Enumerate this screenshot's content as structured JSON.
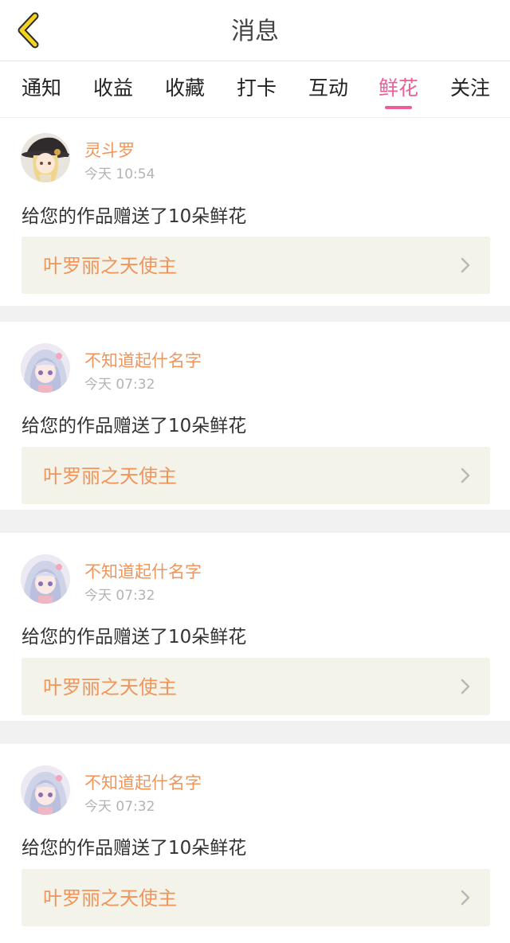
{
  "header": {
    "title": "消息"
  },
  "tabs": [
    {
      "label": "通知",
      "active": false
    },
    {
      "label": "收益",
      "active": false
    },
    {
      "label": "收藏",
      "active": false
    },
    {
      "label": "打卡",
      "active": false
    },
    {
      "label": "互动",
      "active": false
    },
    {
      "label": "鲜花",
      "active": true
    },
    {
      "label": "关注",
      "active": false
    }
  ],
  "colors": {
    "accent": "#ec5d99",
    "username": "#f0945a",
    "work_link_bg": "#f4f3ea"
  },
  "messages": [
    {
      "avatar": "witch-girl-avatar",
      "username": "灵斗罗",
      "time": "今天 10:54",
      "text": "给您的作品赠送了10朵鲜花",
      "work_title": "叶罗丽之天使主"
    },
    {
      "avatar": "silver-hair-girl-avatar",
      "username": "不知道起什名字",
      "time": "今天 07:32",
      "text": "给您的作品赠送了10朵鲜花",
      "work_title": "叶罗丽之天使主"
    },
    {
      "avatar": "silver-hair-girl-avatar",
      "username": "不知道起什名字",
      "time": "今天 07:32",
      "text": "给您的作品赠送了10朵鲜花",
      "work_title": "叶罗丽之天使主"
    },
    {
      "avatar": "silver-hair-girl-avatar",
      "username": "不知道起什名字",
      "time": "今天 07:32",
      "text": "给您的作品赠送了10朵鲜花",
      "work_title": "叶罗丽之天使主"
    }
  ]
}
